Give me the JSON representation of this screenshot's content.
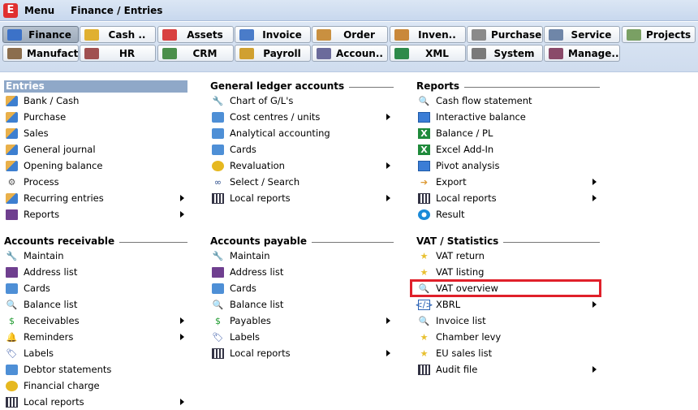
{
  "titlebar": {
    "logo": "E",
    "menu": "Menu",
    "breadcrumb": "Finance / Entries"
  },
  "toolbar": {
    "row1": [
      {
        "label": "Finance",
        "icon": "finance-icon",
        "active": true
      },
      {
        "label": "Cash ..",
        "icon": "cash-icon"
      },
      {
        "label": "Assets",
        "icon": "assets-icon"
      },
      {
        "label": "Invoice",
        "icon": "invoice-icon"
      },
      {
        "label": "Order",
        "icon": "order-icon"
      },
      {
        "label": "Inven..",
        "icon": "inventory-icon"
      },
      {
        "label": "Purchase",
        "icon": "purchase-icon"
      },
      {
        "label": "Service",
        "icon": "service-icon"
      },
      {
        "label": "Projects",
        "icon": "projects-icon"
      }
    ],
    "row2": [
      {
        "label": "Manufact..",
        "icon": "manufacturing-icon"
      },
      {
        "label": "HR",
        "icon": "hr-icon"
      },
      {
        "label": "CRM",
        "icon": "crm-icon"
      },
      {
        "label": "Payroll",
        "icon": "payroll-icon"
      },
      {
        "label": "Accoun..",
        "icon": "accounting-icon"
      },
      {
        "label": "XML",
        "icon": "xml-icon"
      },
      {
        "label": "System",
        "icon": "system-icon"
      },
      {
        "label": "Manage..",
        "icon": "management-icon"
      }
    ]
  },
  "sections": {
    "entries": {
      "title": "Entries",
      "items": [
        {
          "label": "Bank / Cash",
          "icon": "doc"
        },
        {
          "label": "Purchase",
          "icon": "doc"
        },
        {
          "label": "Sales",
          "icon": "doc"
        },
        {
          "label": "General journal",
          "icon": "doc"
        },
        {
          "label": "Opening balance",
          "icon": "doc"
        },
        {
          "label": "Process",
          "icon": "gear"
        },
        {
          "label": "Recurring entries",
          "icon": "doc",
          "submenu": true
        },
        {
          "label": "Reports",
          "icon": "book",
          "submenu": true
        }
      ]
    },
    "gl": {
      "title": "General ledger accounts",
      "items": [
        {
          "label": "Chart of G/L's",
          "icon": "wrench"
        },
        {
          "label": "Cost centres / units",
          "icon": "card",
          "submenu": true
        },
        {
          "label": "Analytical accounting",
          "icon": "card"
        },
        {
          "label": "Cards",
          "icon": "card"
        },
        {
          "label": "Revaluation",
          "icon": "coin",
          "submenu": true
        },
        {
          "label": "Select / Search",
          "icon": "bino"
        },
        {
          "label": "Local reports",
          "icon": "grid",
          "submenu": true
        }
      ]
    },
    "reports": {
      "title": "Reports",
      "items": [
        {
          "label": "Cash flow statement",
          "icon": "mag"
        },
        {
          "label": "Interactive balance",
          "icon": "table"
        },
        {
          "label": "Balance / PL",
          "icon": "xl"
        },
        {
          "label": "Excel Add-In",
          "icon": "xl"
        },
        {
          "label": "Pivot analysis",
          "icon": "table"
        },
        {
          "label": "Export",
          "icon": "exp",
          "submenu": true
        },
        {
          "label": "Local reports",
          "icon": "grid",
          "submenu": true
        },
        {
          "label": "Result",
          "icon": "res"
        }
      ]
    },
    "ar": {
      "title": "Accounts receivable",
      "items": [
        {
          "label": "Maintain",
          "icon": "wrench"
        },
        {
          "label": "Address list",
          "icon": "book"
        },
        {
          "label": "Cards",
          "icon": "card"
        },
        {
          "label": "Balance list",
          "icon": "mag"
        },
        {
          "label": "Receivables",
          "icon": "green",
          "submenu": true
        },
        {
          "label": "Reminders",
          "icon": "bell",
          "submenu": true
        },
        {
          "label": "Labels",
          "icon": "tag"
        },
        {
          "label": "Debtor statements",
          "icon": "card"
        },
        {
          "label": "Financial charge",
          "icon": "coin"
        },
        {
          "label": "Local reports",
          "icon": "grid",
          "submenu": true
        }
      ]
    },
    "ap": {
      "title": "Accounts payable",
      "items": [
        {
          "label": "Maintain",
          "icon": "wrench"
        },
        {
          "label": "Address list",
          "icon": "book"
        },
        {
          "label": "Cards",
          "icon": "card"
        },
        {
          "label": "Balance list",
          "icon": "mag"
        },
        {
          "label": "Payables",
          "icon": "green",
          "submenu": true
        },
        {
          "label": "Labels",
          "icon": "tag"
        },
        {
          "label": "Local reports",
          "icon": "grid",
          "submenu": true
        }
      ]
    },
    "vat": {
      "title": "VAT / Statistics",
      "items": [
        {
          "label": "VAT return",
          "icon": "vat"
        },
        {
          "label": "VAT listing",
          "icon": "vat"
        },
        {
          "label": "VAT overview",
          "icon": "mag",
          "highlighted": true
        },
        {
          "label": "XBRL",
          "icon": "xbrl",
          "submenu": true
        },
        {
          "label": "Invoice list",
          "icon": "mag"
        },
        {
          "label": "Chamber levy",
          "icon": "vat"
        },
        {
          "label": "EU sales list",
          "icon": "vat"
        },
        {
          "label": "Audit file",
          "icon": "grid",
          "submenu": true
        }
      ]
    }
  },
  "colors": {
    "highlight": "#e0202a",
    "entries_header_bg": "#8fa8c8",
    "toolbar_bg": "#dce7f5"
  }
}
